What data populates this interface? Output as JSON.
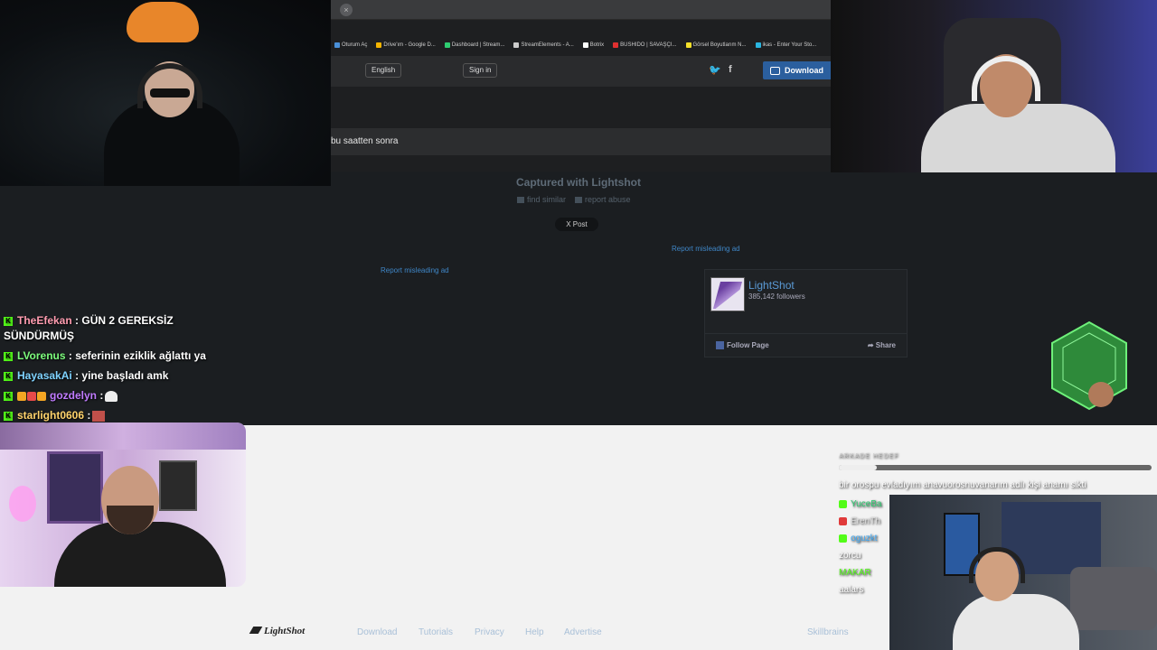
{
  "browser": {
    "bookmarks": [
      {
        "label": "Oturum Aç",
        "color": "#4a90d9"
      },
      {
        "label": "Drive'ım - Google D...",
        "color": "#f5b400"
      },
      {
        "label": "Dashboard | Stream...",
        "color": "#2ecc71"
      },
      {
        "label": "StreamElements - A...",
        "color": "#cccccc"
      },
      {
        "label": "Botrix",
        "color": "#ffffff"
      },
      {
        "label": "BUSHIDO | SAVAŞÇI...",
        "color": "#e03030"
      },
      {
        "label": "Görsel Boyutlarım N...",
        "color": "#f5e02a"
      },
      {
        "label": "ikas - Enter Your Sto...",
        "color": "#2ab5e0"
      }
    ],
    "language": "English",
    "sign_in": "Sign in",
    "download": "Download",
    "comment": "bu saatten sonra"
  },
  "lightshot": {
    "captured": "Captured with Lightshot",
    "find_similar": "find similar",
    "report_abuse": "report abuse",
    "x_post": "X Post",
    "report_misleading_1": "Report misleading ad",
    "report_misleading_2": "Report misleading ad",
    "fb_name": "LightShot",
    "fb_followers": "385,142 followers",
    "fb_follow": "Follow Page",
    "fb_share": "Share"
  },
  "footer": {
    "logo": "LightShot",
    "links": [
      "Download",
      "Tutorials",
      "Privacy",
      "Help",
      "Advertise"
    ],
    "right": "Skillbrains"
  },
  "chat": [
    {
      "user": "TheEfekan",
      "user_color": "#ff9cb0",
      "message": ": GÜN 2 GEREKSİZ SÜNDÜRMÜŞ"
    },
    {
      "user": "LVorenus",
      "user_color": "#7cfc7c",
      "message": ": seferinin eziklik ağlattı ya"
    },
    {
      "user": "HayasakAi",
      "user_color": "#7fd3ff",
      "message": ": yine başladı amk"
    },
    {
      "user": "gozdelyn",
      "user_color": "#c07bff",
      "message": ":"
    },
    {
      "user": "starlight0606",
      "user_color": "#ffd36b",
      "message": ":"
    }
  ],
  "chat2": {
    "title": "ARKADE HEDEF",
    "progress": 0.12,
    "message": "bir orospu evladıyım anavuorosnuvanarım adlı kişi anamı sikti",
    "users": [
      {
        "name": "YuceBa",
        "color": "#2ecc71"
      },
      {
        "name": "ErenTh",
        "color": "#dddddd"
      },
      {
        "name": "oguzkt",
        "color": "#3fa9f5"
      },
      {
        "name": "zorcu",
        "color": "#ffffff"
      },
      {
        "name": "MAKAR",
        "color": "#53fc18"
      },
      {
        "name": "aalars",
        "color": "#ffffff"
      }
    ]
  }
}
